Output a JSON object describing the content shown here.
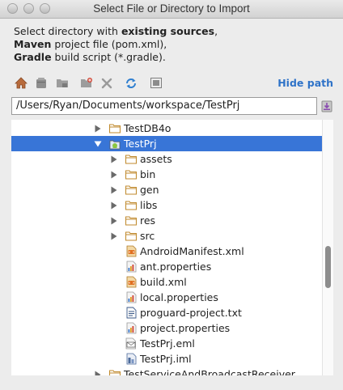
{
  "window": {
    "title": "Select File or Directory to Import"
  },
  "description": {
    "line1_normal": "Select directory with ",
    "line1_bold": "existing sources",
    "line1_end": ",",
    "line2_bold": "Maven",
    "line2_normal": " project file (pom.xml),",
    "line3_bold": "Gradle",
    "line3_normal": " build script (*.gradle)."
  },
  "toolbar": {
    "icons": [
      "home-icon",
      "android-icon",
      "module-icon",
      "new-folder-icon",
      "delete-icon",
      "refresh-icon",
      "show-hidden-icon"
    ],
    "hide_path_label": "Hide path"
  },
  "path_field": {
    "value": "/Users/Ryan/Documents/workspace/TestPrj"
  },
  "tree": {
    "items": [
      {
        "label": "TestDB4o",
        "icon": "folder-icon",
        "level": 0,
        "arrow": "collapsed",
        "selected": false
      },
      {
        "label": "TestPrj",
        "icon": "android-project-icon",
        "level": 0,
        "arrow": "expanded",
        "selected": true
      },
      {
        "label": "assets",
        "icon": "folder-icon",
        "level": 1,
        "arrow": "collapsed",
        "selected": false
      },
      {
        "label": "bin",
        "icon": "folder-icon",
        "level": 1,
        "arrow": "collapsed",
        "selected": false
      },
      {
        "label": "gen",
        "icon": "folder-icon",
        "level": 1,
        "arrow": "collapsed",
        "selected": false
      },
      {
        "label": "libs",
        "icon": "folder-icon",
        "level": 1,
        "arrow": "collapsed",
        "selected": false
      },
      {
        "label": "res",
        "icon": "folder-icon",
        "level": 1,
        "arrow": "collapsed",
        "selected": false
      },
      {
        "label": "src",
        "icon": "folder-icon",
        "level": 1,
        "arrow": "collapsed",
        "selected": false
      },
      {
        "label": "AndroidManifest.xml",
        "icon": "xml-file-icon",
        "level": 1,
        "arrow": "none",
        "selected": false
      },
      {
        "label": "ant.properties",
        "icon": "properties-file-icon",
        "level": 1,
        "arrow": "none",
        "selected": false
      },
      {
        "label": "build.xml",
        "icon": "xml-file-icon",
        "level": 1,
        "arrow": "none",
        "selected": false
      },
      {
        "label": "local.properties",
        "icon": "properties-file-icon",
        "level": 1,
        "arrow": "none",
        "selected": false
      },
      {
        "label": "proguard-project.txt",
        "icon": "text-file-icon",
        "level": 1,
        "arrow": "none",
        "selected": false
      },
      {
        "label": "project.properties",
        "icon": "properties-file-icon",
        "level": 1,
        "arrow": "none",
        "selected": false
      },
      {
        "label": "TestPrj.eml",
        "icon": "eml-file-icon",
        "level": 1,
        "arrow": "none",
        "selected": false
      },
      {
        "label": "TestPrj.iml",
        "icon": "iml-file-icon",
        "level": 1,
        "arrow": "none",
        "selected": false
      },
      {
        "label": "TestServiceAndBroadcastReceiver",
        "icon": "folder-icon",
        "level": 0,
        "arrow": "collapsed",
        "selected": false
      }
    ]
  },
  "colors": {
    "selection": "#3875d7",
    "link": "#2f73c8",
    "folder": "#c8a24a"
  }
}
